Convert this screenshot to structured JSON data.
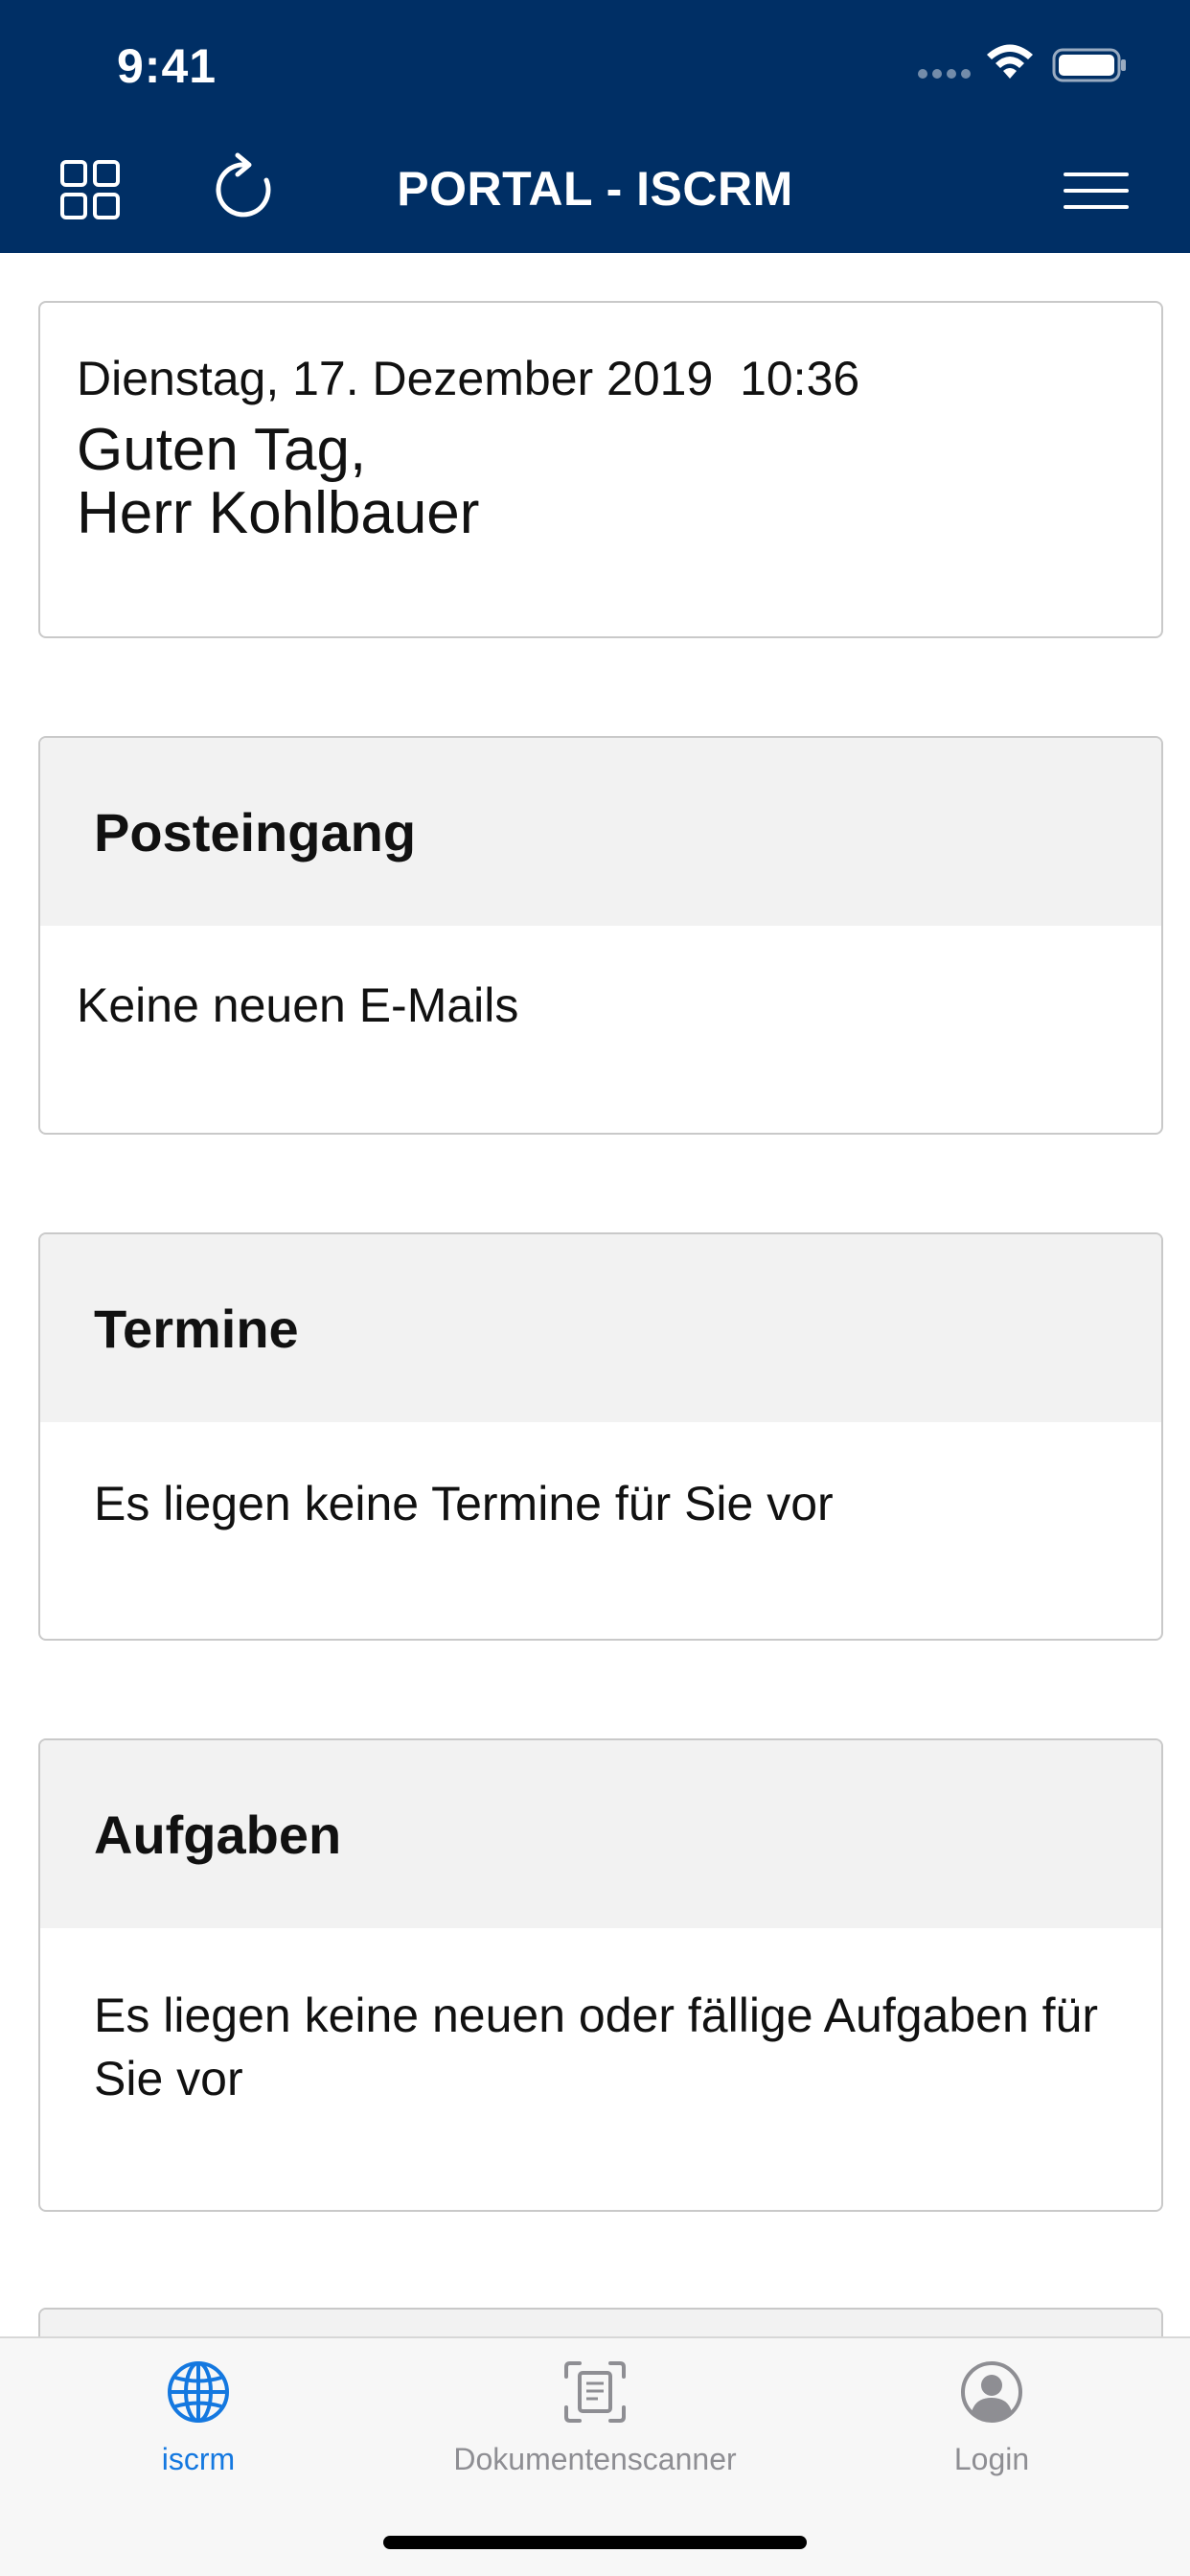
{
  "status_bar": {
    "time": "9:41"
  },
  "header": {
    "title": "PORTAL - ISCRM",
    "background_color": "#002f65",
    "icons": [
      "grid-icon",
      "refresh-icon",
      "menu-icon"
    ]
  },
  "greeting": {
    "date": "Dienstag, 17. Dezember 2019  10:36",
    "line1": "Guten Tag,",
    "line2": "Herr Kohlbauer"
  },
  "cards": {
    "inbox": {
      "title": "Posteingang",
      "text": "Keine neuen E-Mails"
    },
    "appointments": {
      "title": "Termine",
      "text": "Es liegen keine Termine für Sie vor"
    },
    "tasks": {
      "title": "Aufgaben",
      "text": "Es liegen keine neuen oder fällige Aufgaben für Sie vor"
    }
  },
  "tabbar": {
    "active_color": "#1478e0",
    "inactive_color": "#8e8e93",
    "tabs": [
      {
        "label": "iscrm",
        "icon": "globe-icon",
        "active": true
      },
      {
        "label": "Dokumentenscanner",
        "icon": "document-scanner-icon",
        "active": false
      },
      {
        "label": "Login",
        "icon": "user-circle-icon",
        "active": false
      }
    ]
  }
}
